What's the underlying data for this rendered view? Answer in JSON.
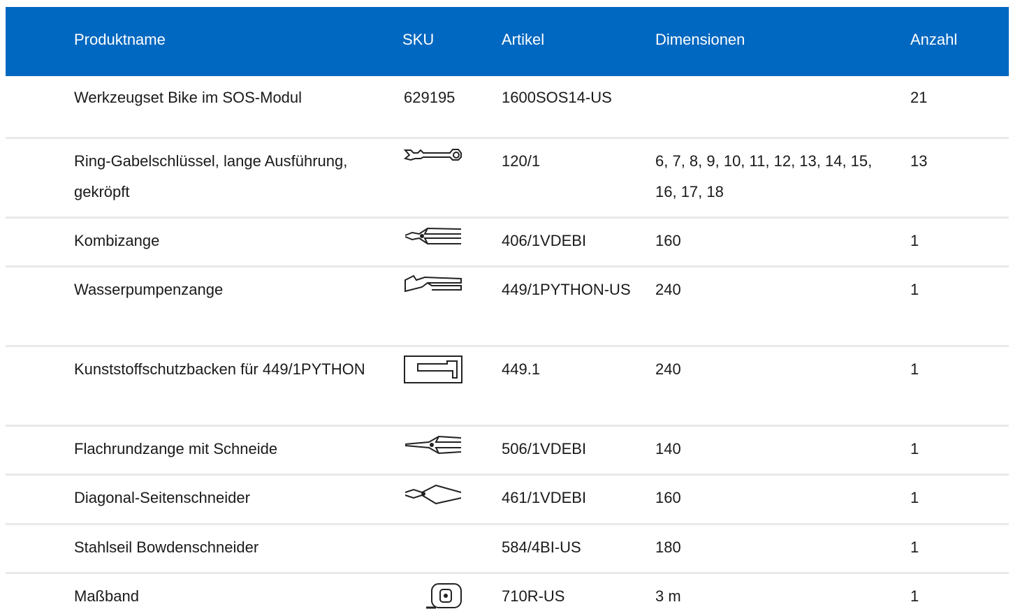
{
  "header": {
    "name": "Produktname",
    "sku": "SKU",
    "article": "Artikel",
    "dimensions": "Dimensionen",
    "quantity": "Anzahl"
  },
  "colors": {
    "header_bg": "#0068c0",
    "header_text": "#ffffff",
    "row_divider": "#e9e9e9"
  },
  "rows": [
    {
      "name": "Werkzeugset Bike im SOS-Modul",
      "sku": "629195",
      "article": "1600SOS14-US",
      "dimensions": "",
      "quantity": "21",
      "icon": ""
    },
    {
      "name": "Ring-Gabelschlüssel, lange Ausführung, gekröpft",
      "sku": "",
      "article": "120/1",
      "dimensions": "6, 7, 8, 9, 10, 11, 12, 13, 14, 15, 16, 17, 18",
      "quantity": "13",
      "icon": "combination-wrench-icon"
    },
    {
      "name": "Kombizange",
      "sku": "",
      "article": "406/1VDEBI",
      "dimensions": "160",
      "quantity": "1",
      "icon": "combination-pliers-icon"
    },
    {
      "name": "Wasserpumpenzange",
      "sku": "",
      "article": "449/1PYTHON-US",
      "dimensions": "240",
      "quantity": "1",
      "icon": "water-pump-pliers-icon"
    },
    {
      "name": "Kunststoffschutzbacken für 449/1PYTHON",
      "sku": "",
      "article": "449.1",
      "dimensions": "240",
      "quantity": "1",
      "icon": "protective-jaws-icon"
    },
    {
      "name": "Flachrundzange mit Schneide",
      "sku": "",
      "article": "506/1VDEBI",
      "dimensions": "140",
      "quantity": "1",
      "icon": "flat-round-pliers-icon"
    },
    {
      "name": "Diagonal-Seitenschneider",
      "sku": "",
      "article": "461/1VDEBI",
      "dimensions": "160",
      "quantity": "1",
      "icon": "diagonal-cutter-icon"
    },
    {
      "name": "Stahlseil Bowdenschneider",
      "sku": "",
      "article": "584/4BI-US",
      "dimensions": "180",
      "quantity": "1",
      "icon": ""
    },
    {
      "name": "Maßband",
      "sku": "",
      "article": "710R-US",
      "dimensions": "3 m",
      "quantity": "1",
      "icon": "tape-measure-icon"
    }
  ]
}
